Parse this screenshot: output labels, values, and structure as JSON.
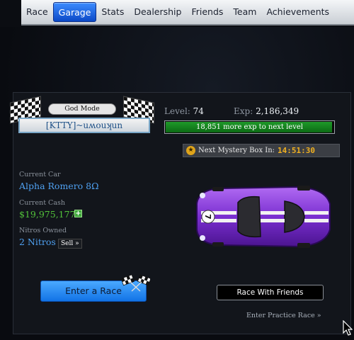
{
  "nav": {
    "items": [
      {
        "label": "Race",
        "active": false
      },
      {
        "label": "Garage",
        "active": true
      },
      {
        "label": "Stats",
        "active": false
      },
      {
        "label": "Dealership",
        "active": false
      },
      {
        "label": "Friends",
        "active": false
      },
      {
        "label": "Team",
        "active": false
      },
      {
        "label": "Achievements",
        "active": false
      }
    ]
  },
  "badge": {
    "title": "God Mode",
    "name": "[KTTY]~uʍouʞun"
  },
  "player": {
    "level_label": "Level:",
    "level_value": "74",
    "exp_label": "Exp:",
    "exp_value": "2,186,349",
    "exp_to_next": "18,851 more exp to next level",
    "exp_progress": 0.99
  },
  "mystery_box": {
    "label": "Next Mystery Box In:",
    "time": "14:51:30"
  },
  "car": {
    "label": "Current Car",
    "value": "Alpha Romero 8Ω",
    "color": "#7a2fd0",
    "number": "7"
  },
  "cash": {
    "label": "Current Cash",
    "value": "$19,975,177"
  },
  "nitros": {
    "label": "Nitros Owned",
    "value": "2 Nitros",
    "sell_label": "Sell »"
  },
  "actions": {
    "enter_race": "Enter a Race",
    "race_friends": "Race With Friends",
    "practice": "Enter Practice Race »"
  },
  "colors": {
    "accent_blue": "#1273e6",
    "exp_green": "#1f9a2a",
    "timer_orange": "#f0b020"
  }
}
